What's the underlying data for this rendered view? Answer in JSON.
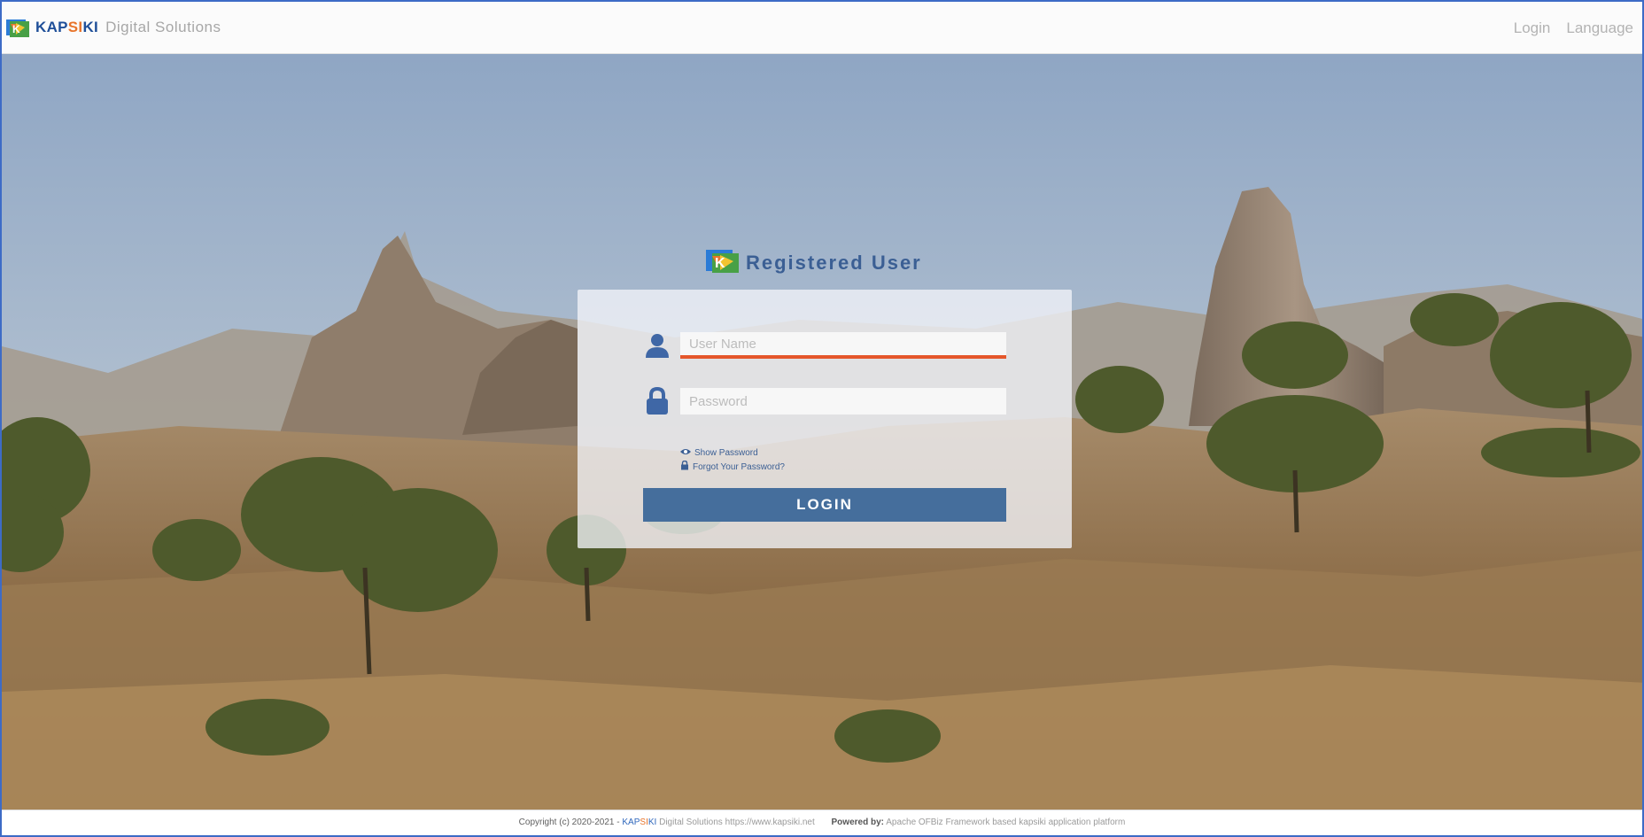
{
  "header": {
    "brand": {
      "kap": "KAP",
      "si": "SI",
      "ki": "KI",
      "rest": "Digital Solutions"
    },
    "nav": [
      {
        "label": "Login"
      },
      {
        "label": "Language"
      }
    ]
  },
  "login": {
    "title": "Registered User",
    "username_placeholder": "User Name",
    "password_placeholder": "Password",
    "show_password": "Show Password",
    "forgot_password": "Forgot Your Password?",
    "login_button": "LOGIN"
  },
  "footer": {
    "copyright": "Copyright (c) 2020-2021 - ",
    "kap": "KAP",
    "si": "SI",
    "ki": "KI",
    "company": " Digital Solutions https://www.kapsiki.net",
    "powered_label": "Powered by:",
    "powered_text": " Apache OFBiz Framework based kapsiki application platform"
  },
  "colors": {
    "brand_blue": "#1f4f99",
    "brand_orange": "#e8742a",
    "button": "#456e9c",
    "input_focus": "#e5572b"
  },
  "icons": {
    "user": "user-icon",
    "lock": "lock-icon",
    "eye": "eye-icon",
    "logo": "kapsiki-logo-icon"
  }
}
